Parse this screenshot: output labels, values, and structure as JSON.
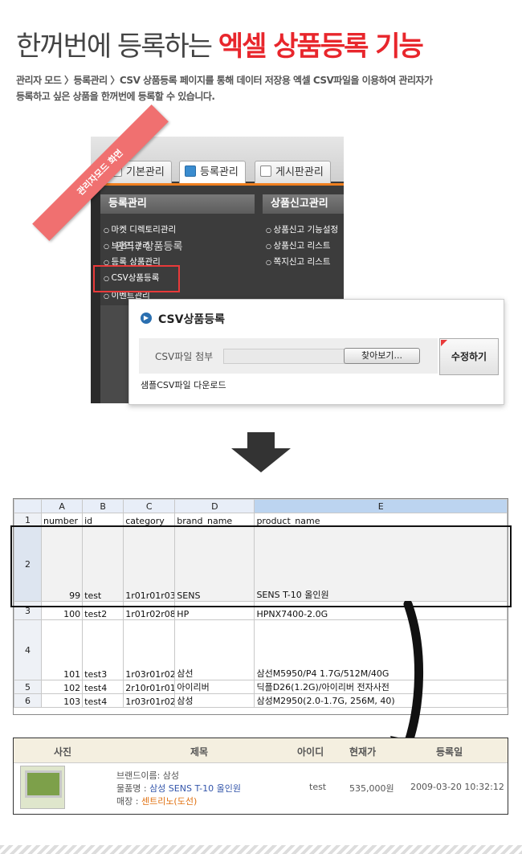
{
  "heading": {
    "plain": "한꺼번에 등록하는 ",
    "highlight": "엑셀 상품등록 기능"
  },
  "description": {
    "line1": "관리자 모드 〉등록관리 〉CSV 상품등록 페이지를 통해 데이터 저장용 엑셀 CSV파일을 이용하여 관리자가",
    "line2": "등록하고 싶은 상품을 한꺼번에 등록할 수 있습니다."
  },
  "ribbon": "관리자모드 화면",
  "admin": {
    "tabs": [
      "기본관리",
      "등록관리",
      "게시판관리"
    ],
    "active_tab": 1,
    "menu_heads": [
      "등록관리",
      "상품신고관리"
    ],
    "left_items": [
      "마켓 디렉토리관리",
      "브랜드관리",
      "등록 상품관리",
      "CSV상품등록",
      "이벤트관리"
    ],
    "right_items": [
      "상품신고 기능설정",
      "상품신고 리스트",
      "쪽지신고 리스트"
    ],
    "ghost_text": "관리 / 상품등록"
  },
  "popup": {
    "title": "CSV상품등록",
    "attach_label": "CSV파일 첨부",
    "browse_label": "찾아보기...",
    "save_label": "수정하기",
    "sample_link": "샘플CSV파일 다운로드"
  },
  "sheet": {
    "columns": [
      "A",
      "B",
      "C",
      "D",
      "E"
    ],
    "header_row": [
      "number",
      "id",
      "category",
      "brand_name",
      "product_name"
    ],
    "rows": [
      {
        "row": "2",
        "number": "99",
        "id": "test",
        "category": "1r01r01r03",
        "brand": "SENS",
        "product": "SENS T-10 올인원"
      },
      {
        "row": "3",
        "number": "100",
        "id": "test2",
        "category": "1r01r02r08",
        "brand": "HP",
        "product": "HPNX7400-2.0G"
      },
      {
        "row": "4",
        "number": "101",
        "id": "test3",
        "category": "1r03r01r02",
        "brand": "삼선",
        "product": "삼선M5950/P4 1.7G/512M/40G"
      },
      {
        "row": "5",
        "number": "102",
        "id": "test4",
        "category": "2r10r01r01",
        "brand": "아이리버",
        "product": "딕플D26(1.2G)/아이리버 전자사전"
      },
      {
        "row": "6",
        "number": "103",
        "id": "test4",
        "category": "1r03r01r02",
        "brand": "삼성",
        "product": "삼성M2950(2.0-1.7G, 256M, 40)"
      }
    ]
  },
  "result": {
    "headers": [
      "사진",
      "제목",
      "아이디",
      "현재가",
      "등록일"
    ],
    "brand_line": "브랜드이름: 삼성",
    "product_label": "물품명 : ",
    "product_name": "삼성 SENS T-10 올인원",
    "shop_label": "매장 : ",
    "shop_name": "센트리노(도선)",
    "user_id": "test",
    "price": "535,000원",
    "date": "2009-03-20 10:32:12",
    "colors": {
      "product": "#3355aa",
      "shop": "#e07010"
    }
  },
  "colors": {
    "accent": "#e8262c",
    "orange": "#f08020"
  }
}
